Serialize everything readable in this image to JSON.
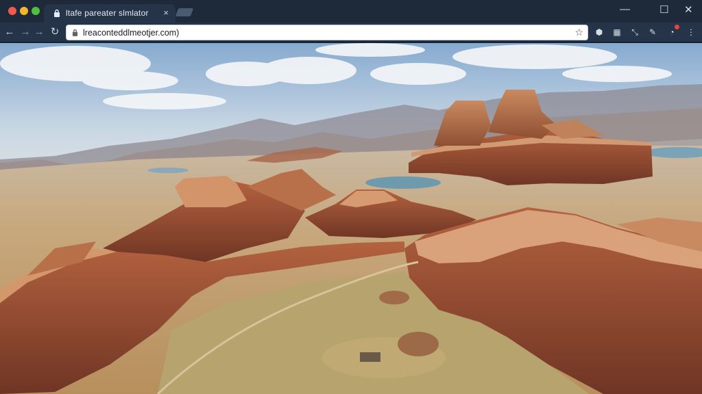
{
  "browser": {
    "tab": {
      "title": "ltafe pareater slmlator",
      "close_glyph": "×"
    },
    "window_controls": {
      "minimize": "—",
      "maximize": "☐",
      "close": "✕"
    },
    "toolbar": {
      "back_glyph": "←",
      "forward_glyph": "→",
      "forward2_glyph": "→",
      "reload_glyph": "↻",
      "url": "lreaconteddlmeotjer.com)",
      "star_glyph": "☆"
    },
    "extensions": [
      "puzzle-icon",
      "grid-icon",
      "cursor-icon",
      "pen-icon",
      "notification-icon",
      "menu-icon"
    ]
  },
  "scene": {
    "description_colors": {
      "sky_top": "#8fb2d6",
      "sky_bottom": "#e9eef2",
      "mesa": "#b06a45",
      "mesa_light": "#d79b72",
      "ground": "#c8a777",
      "water": "#7aa0b2"
    }
  }
}
